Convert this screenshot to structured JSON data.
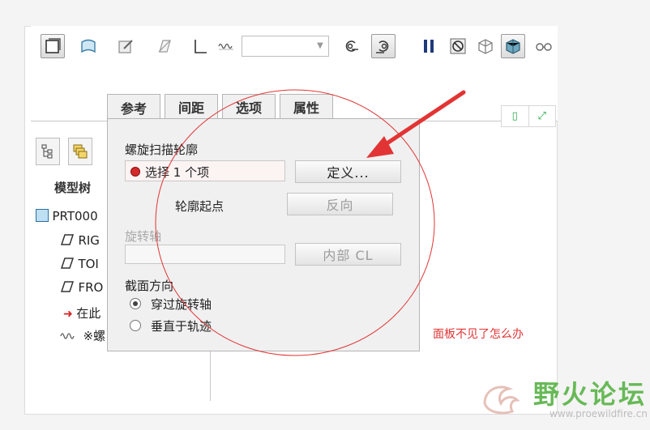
{
  "toolbar": {
    "combo_value": "",
    "icons": [
      "solid-icon",
      "surface-icon",
      "sketch-icon",
      "remove-material-icon",
      "thicken-icon",
      "helical-pitch-icon",
      "profile-left-icon",
      "profile-right-icon",
      "pause-icon",
      "stop-icon",
      "preview-frame-icon",
      "preview-shade-icon",
      "glasses-icon"
    ]
  },
  "tree": {
    "tabs": [
      "model-tree-tab",
      "layer-tab"
    ],
    "header": "模型树",
    "items": [
      {
        "icon": "part-icon",
        "label": "PRT000"
      },
      {
        "icon": "datum-plane-icon",
        "label": "RIG"
      },
      {
        "icon": "datum-plane-icon",
        "label": "TOI"
      },
      {
        "icon": "datum-plane-icon",
        "label": "FRO"
      },
      {
        "icon": "insert-arrow-icon",
        "label": "在此"
      },
      {
        "icon": "helical-icon",
        "label": "※螺"
      }
    ]
  },
  "dialog": {
    "tabs": [
      "参考",
      "间距",
      "选项",
      "属性"
    ],
    "active_tab": "参考",
    "sweep_profile_label": "螺旋扫描轮廓",
    "selection_text": "选择 1 个项",
    "define_button": "定义...",
    "profile_start_label": "轮廓起点",
    "reverse_button": "反向",
    "rotation_axis_label": "旋转轴",
    "rotation_axis_value": "",
    "internal_cl_button": "内部 CL",
    "section_direction_label": "截面方向",
    "radio_options": [
      {
        "label": "穿过旋转轴",
        "selected": true
      },
      {
        "label": "垂直于轨迹",
        "selected": false
      }
    ]
  },
  "annotation": {
    "question": "面板不见了怎么办",
    "color": "#e23434"
  },
  "watermark": {
    "logo_text": "野火论坛",
    "url": "www.proewildfire.cn"
  }
}
